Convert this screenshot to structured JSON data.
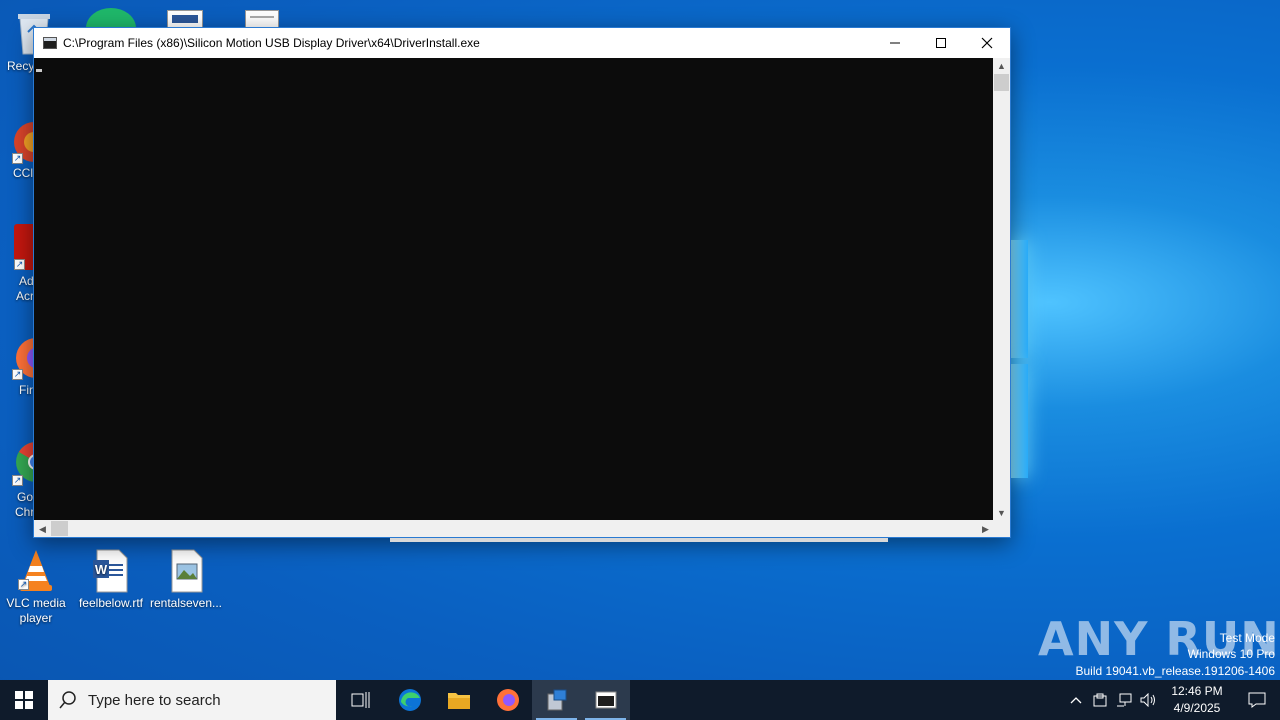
{
  "console": {
    "title": "C:\\Program Files (x86)\\Silicon Motion USB Display Driver\\x64\\DriverInstall.exe",
    "icon": "console-app-icon"
  },
  "desktop": {
    "partial_labels": {
      "recycle": "Recy",
      "ccleaner": "CCl",
      "adobe_1": "Ad",
      "adobe_2": "Acr",
      "firefox": "Fir",
      "chrome_1": "Go",
      "chrome_2": "Chr"
    },
    "icons": [
      {
        "label_1": "VLC media",
        "label_2": "player",
        "icon": "vlc-icon"
      },
      {
        "label_1": "feelbelow.rtf",
        "label_2": "",
        "icon": "word-document-icon"
      },
      {
        "label_1": "rentalseven...",
        "label_2": "",
        "icon": "image-file-icon"
      }
    ]
  },
  "watermark": {
    "brand": "ANY RUN",
    "line1": "Test Mode",
    "line2": "Windows 10 Pro",
    "line3": "Build 19041.vb_release.191206-1406"
  },
  "taskbar": {
    "search_placeholder": "Type here to search",
    "time": "12:46 PM",
    "date": "4/9/2025"
  },
  "colors": {
    "taskbar": "#0f1b2b",
    "console_bg": "#0c0c0c",
    "accent": "#7eb4ea"
  }
}
